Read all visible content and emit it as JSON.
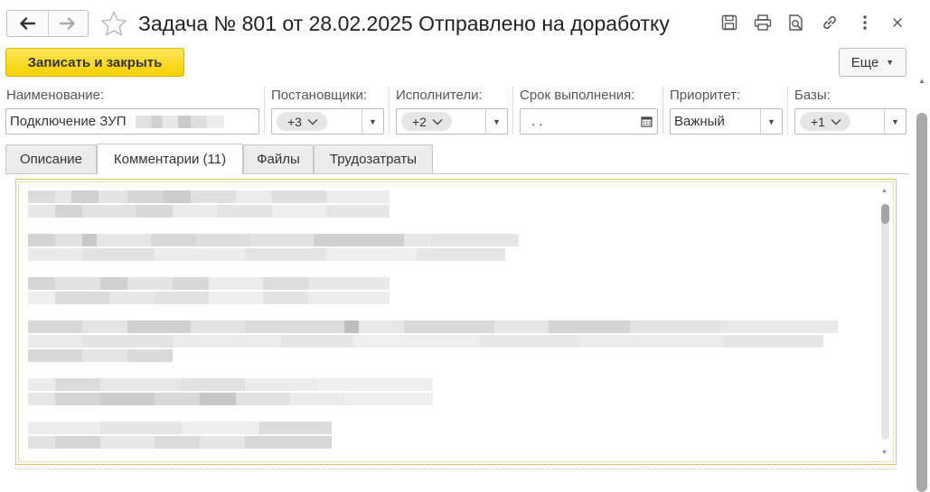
{
  "window": {
    "title": "Задача № 801 от 28.02.2025 Отправлено на доработку"
  },
  "toolbar": {
    "save_close_label": "Записать и закрыть",
    "more_label": "Еще"
  },
  "fields": {
    "name": {
      "label": "Наименование:",
      "value": "Подключение ЗУП"
    },
    "setters": {
      "label": "Постановщики:",
      "value": "+3"
    },
    "executors": {
      "label": "Исполнители:",
      "value": "+2"
    },
    "deadline": {
      "label": "Срок выполнения:",
      "value": " .  ."
    },
    "priority": {
      "label": "Приоритет:",
      "value": "Важный"
    },
    "bases": {
      "label": "Базы:",
      "value": "+1"
    }
  },
  "tabs": [
    {
      "label": "Описание"
    },
    {
      "label": "Комментарии (11)"
    },
    {
      "label": "Файлы"
    },
    {
      "label": "Трудозатраты"
    }
  ],
  "colors": {
    "accent_yellow": "#f5d000",
    "panel_border": "#e0c873"
  }
}
